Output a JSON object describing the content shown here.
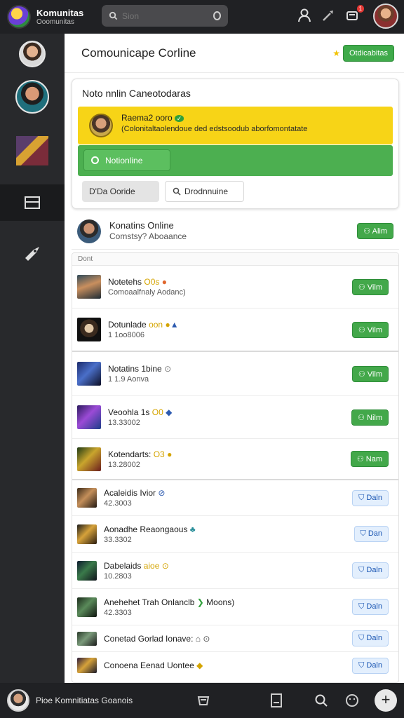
{
  "topbar": {
    "app_title": "Komunitas",
    "app_subtitle": "Ooomunitas",
    "search_placeholder": "Sion",
    "notification_count": "1"
  },
  "rail": {
    "items": [
      "profile-avatar",
      "contact-avatar",
      "game-thumb",
      "list-icon",
      "rocket-icon"
    ]
  },
  "header": {
    "title": "Comounicape Corline",
    "action_label": "Otdicabitas"
  },
  "card": {
    "title": "Noto nnlin Caneotodaras",
    "member_name": "Raema2 ooro",
    "member_desc": "(Colonitaltaolendoue ded edstsoodub aborfomontatate",
    "online_button": "Notionline",
    "button_one": "D'Da Ooride",
    "button_two": "Drodnnuine"
  },
  "featured": {
    "name": "Konatins Online",
    "sub": "Comstsy? Aboaance",
    "action": "Alim"
  },
  "list": {
    "header": "Dont",
    "rows": [
      {
        "name": "Notetehs",
        "badge": "O0s",
        "sub": "Comoaalfnaly Aodanc)",
        "action": "Vilm"
      },
      {
        "name": "Dotunlade",
        "badge": "oon",
        "sub": "1 1oo8006",
        "action": "Vilm"
      },
      {
        "name": "Notatins 1bine",
        "badge": "",
        "sub": "1 1.9 Aonva",
        "action": "Vilm"
      },
      {
        "name": "Veoohla 1s",
        "badge": "O0",
        "sub": "13.33002",
        "action": "Nilm"
      },
      {
        "name": "Kotendarts:",
        "badge": "O3",
        "sub": "13.28002",
        "action": "Nam"
      },
      {
        "name": "Acaleidis Ivior",
        "badge": "",
        "sub": "42.3003",
        "action": "Daln"
      },
      {
        "name": "Aonadhe Reaongaous",
        "badge": "",
        "sub": "33.3302",
        "action": "Dan"
      },
      {
        "name": "Dabelaids",
        "badge": "aioe",
        "sub": "10.2803",
        "action": "Daln"
      },
      {
        "name": "Anehehet Trah Onlanclb",
        "badge": "Moons)",
        "sub": "42.3303",
        "action": "Daln"
      },
      {
        "name": "Conetad Gorlad Ionave:",
        "badge": "",
        "sub": "",
        "action": "Daln"
      },
      {
        "name": "Conoena Eenad Uontee",
        "badge": "",
        "sub": "",
        "action": "Daln"
      }
    ]
  },
  "bottombar": {
    "label": "Pioe Komnitiatas Goanois"
  },
  "colors": {
    "green": "#43a84a",
    "yellow": "#f7d417",
    "dark": "#202124"
  }
}
